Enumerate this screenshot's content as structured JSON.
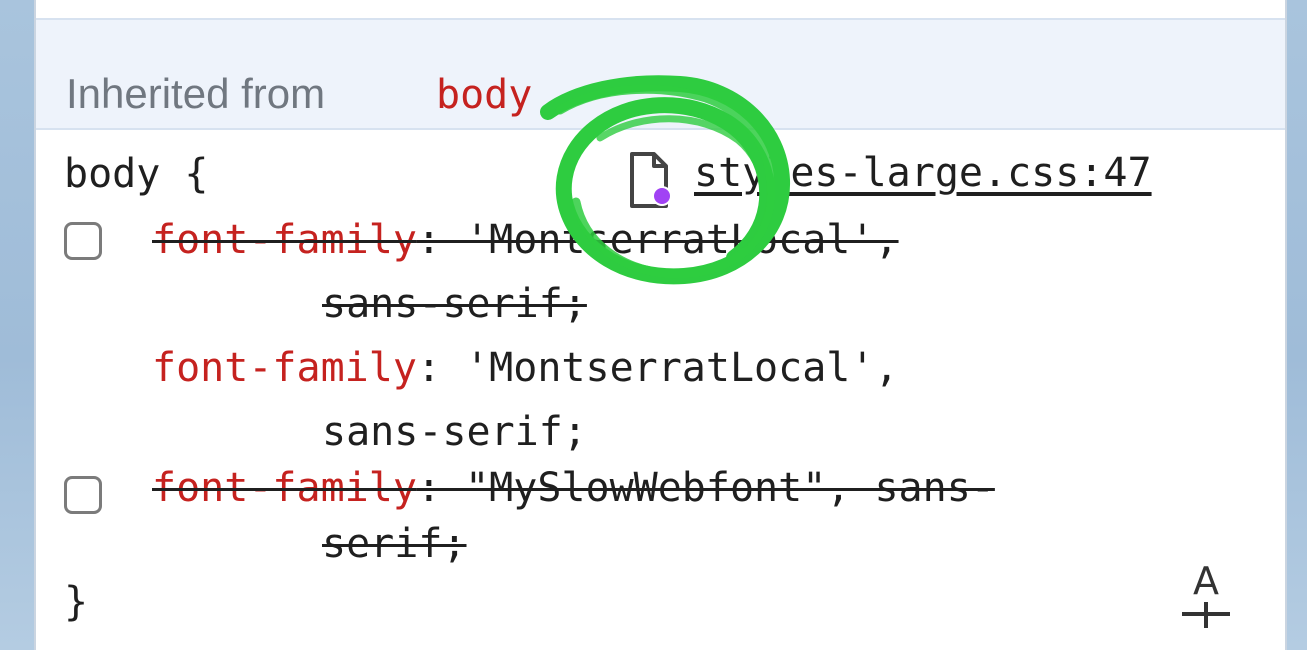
{
  "inherited": {
    "label": "Inherited from",
    "selector": "body"
  },
  "rule": {
    "selector_line": "body {",
    "closing_brace": "}",
    "source": "styles-large.css:47",
    "declarations": [
      {
        "property": "font-family",
        "line1_value": ": 'MontserratLocal',",
        "line2": "sans-serif;",
        "overridden": true,
        "has_checkbox": true
      },
      {
        "property": "font-family",
        "line1_value": ": 'MontserratLocal',",
        "line2": "sans-serif;",
        "overridden": false,
        "has_checkbox": false
      },
      {
        "property": "font-family",
        "line1_value": ": \"MySlowWebfont\", sans-",
        "line2": "serif;",
        "overridden": true,
        "has_checkbox": true
      }
    ]
  },
  "icons": {
    "source_file": "file-icon",
    "font_editor": "font-editor-icon",
    "annotation": "green-circle-annotation"
  },
  "colors": {
    "property": "#c5221f",
    "annotation": "#2ecc40",
    "icon_dot": "#a142f4",
    "header_bg": "#eef3fb"
  }
}
